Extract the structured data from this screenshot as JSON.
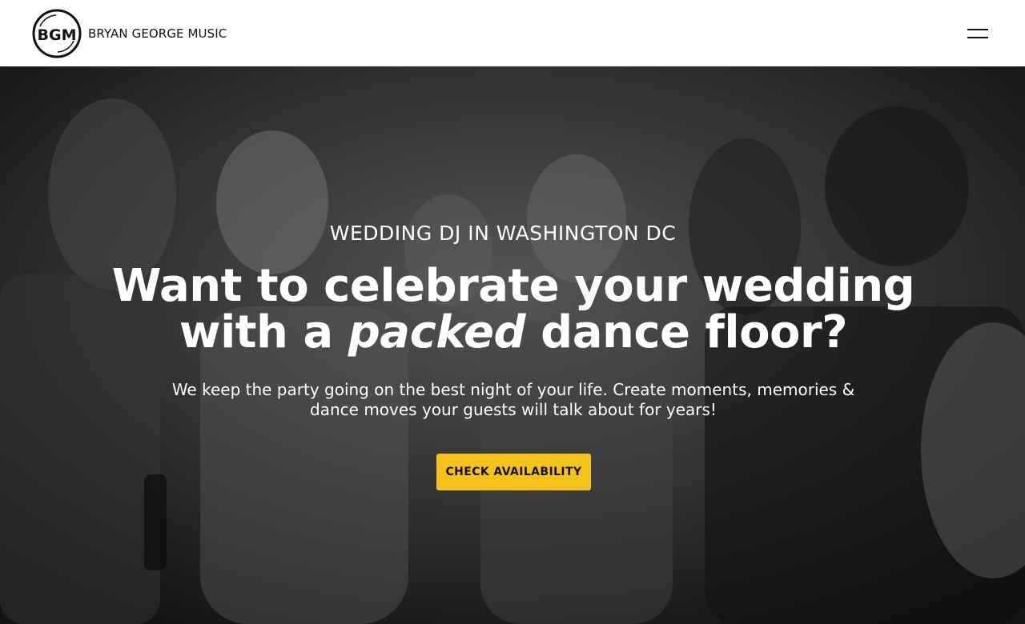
{
  "header": {
    "logo_text": "BGM",
    "brand_name": "BRYAN GEORGE MUSIC",
    "menu_icon": "hamburger-menu-icon"
  },
  "hero": {
    "eyebrow": "WEDDING DJ IN WASHINGTON DC",
    "headline_line1": "Want to celebrate your wedding",
    "headline_line2_start": "with a ",
    "headline_line2_emphasis": "packed",
    "headline_line2_end": " dance floor?",
    "subhead_line1": "We keep the party going on the best night of your life. Create moments, memories &",
    "subhead_line2": "dance moves your guests will talk about for years!",
    "cta_label": "CHECK AVAILABILITY",
    "background": "black-and-white photo of wedding guests dancing"
  },
  "colors": {
    "accent": "#f5c21b",
    "header_bg": "#ffffff",
    "text_dark": "#111111",
    "text_light": "#ffffff"
  }
}
